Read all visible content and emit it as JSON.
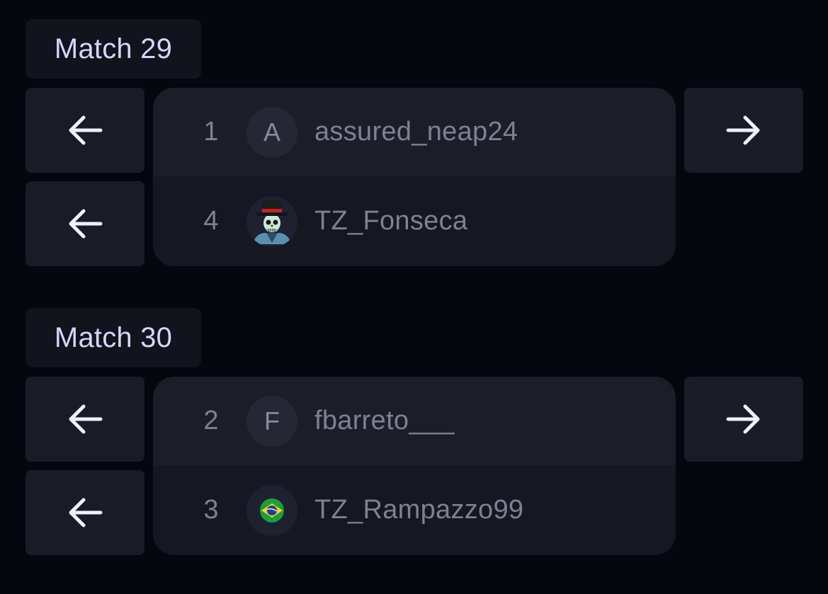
{
  "colors": {
    "background": "#05070f",
    "button": "#191b26",
    "card": "#151722",
    "card_top_slot": "#1b1d29",
    "label_text": "#d3d8fb",
    "muted_text": "#7c8193"
  },
  "matches": [
    {
      "label": "Match 29",
      "buttons": {
        "left_top": "arrow-left-icon",
        "left_bottom": "arrow-left-icon",
        "right": "arrow-right-icon"
      },
      "players": [
        {
          "seed": "1",
          "avatar_letter": "A",
          "avatar_icon": "",
          "name": "assured_neap24"
        },
        {
          "seed": "4",
          "avatar_letter": "",
          "avatar_icon": "skeleton-top-hat-avatar",
          "name": "TZ_Fonseca"
        }
      ]
    },
    {
      "label": "Match 30",
      "buttons": {
        "left_top": "arrow-left-icon",
        "left_bottom": "arrow-left-icon",
        "right": "arrow-right-icon"
      },
      "players": [
        {
          "seed": "2",
          "avatar_letter": "F",
          "avatar_icon": "",
          "name": "fbarreto___"
        },
        {
          "seed": "3",
          "avatar_letter": "",
          "avatar_icon": "brazil-flag-avatar",
          "name": "TZ_Rampazzo99"
        }
      ]
    }
  ]
}
